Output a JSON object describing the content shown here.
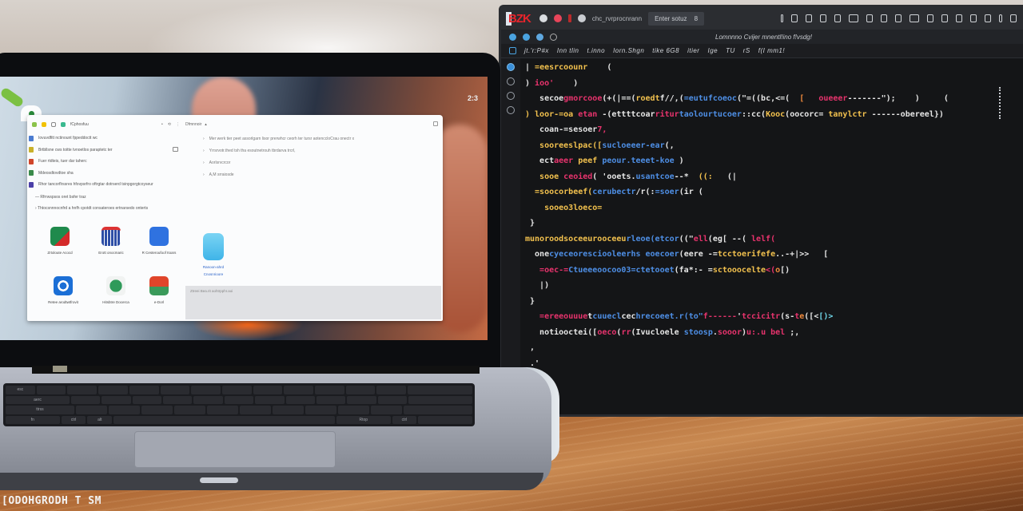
{
  "monitor": {
    "logo": "BZK",
    "topbar_text": "chc_rvrprocnrann",
    "tab_label": "Enter sotuz",
    "tab_count": "8",
    "editor_title": "Lomnnno   Cvijer mnentl!ino f!vsdg!",
    "menu_items": [
      "jt.'r:P#x",
      "Inn tlin",
      "t.inno",
      "Iorn.Shgn",
      "tike 6G8",
      "itier",
      "Ige",
      "TU",
      "rS",
      "f(I mm1!"
    ],
    "code_lines": [
      [
        {
          "t": "| ",
          "c": "w"
        },
        {
          "t": "=eesrcoounr",
          "c": "y"
        },
        {
          "t": "    (",
          "c": "w"
        }
      ],
      [
        {
          "t": ") ",
          "c": "w"
        },
        {
          "t": "ioo'",
          "c": "p"
        },
        {
          "t": "    )",
          "c": "w"
        }
      ],
      [
        {
          "t": "   secoe",
          "c": "w"
        },
        {
          "t": "gmorcooe",
          "c": "p"
        },
        {
          "t": "(+(|==(",
          "c": "w"
        },
        {
          "t": "roedt",
          "c": "y"
        },
        {
          "t": "f//,(",
          "c": "w"
        },
        {
          "t": "=eutufcoeoc",
          "c": "b"
        },
        {
          "t": "(\"=((bc,<=(  ",
          "c": "w"
        },
        {
          "t": "[",
          "c": "o"
        },
        {
          "t": "   ",
          "c": "w"
        },
        {
          "t": "oueeer",
          "c": "p"
        },
        {
          "t": "-------\");    )     (",
          "c": "w"
        }
      ],
      [
        {
          "t": ") loor-=oa ",
          "c": "y"
        },
        {
          "t": "etan",
          "c": "p"
        },
        {
          "t": " -(ettttcoar",
          "c": "w"
        },
        {
          "t": "ritur",
          "c": "p"
        },
        {
          "t": "taolourtucoer",
          "c": "b"
        },
        {
          "t": "::cc(",
          "c": "w"
        },
        {
          "t": "Kooc",
          "c": "y"
        },
        {
          "t": "(oocorc=",
          "c": "w"
        },
        {
          "t": " tanylctr ",
          "c": "y"
        },
        {
          "t": "------obereel",
          "c": "w"
        },
        {
          "t": "})",
          "c": "w"
        }
      ],
      [
        {
          "t": "   coan-=sesoer",
          "c": "w"
        },
        {
          "t": "7,",
          "c": "p"
        }
      ],
      [
        {
          "t": "   sooreeslpac([",
          "c": "y"
        },
        {
          "t": "sucloeeer-ear",
          "c": "b"
        },
        {
          "t": "(,",
          "c": "w"
        }
      ],
      [
        {
          "t": "   ect",
          "c": "w"
        },
        {
          "t": "aeer",
          "c": "p"
        },
        {
          "t": " peef ",
          "c": "y"
        },
        {
          "t": "peour.teeet-koe",
          "c": "b"
        },
        {
          "t": " )",
          "c": "w"
        }
      ],
      [
        {
          "t": "   sooe ",
          "c": "y"
        },
        {
          "t": "ceo",
          "c": "p"
        },
        {
          "t": "ied",
          "c": "p"
        },
        {
          "t": "( 'ooets.",
          "c": "w"
        },
        {
          "t": "usantcoe",
          "c": "b"
        },
        {
          "t": "--*  ",
          "c": "w"
        },
        {
          "t": "((:",
          "c": "y"
        },
        {
          "t": "   (|",
          "c": "w"
        }
      ],
      [
        {
          "t": "  =soocorbeef(",
          "c": "y"
        },
        {
          "t": "cerubectr",
          "c": "b"
        },
        {
          "t": "/r(:",
          "c": "w"
        },
        {
          "t": "=soer",
          "c": "b"
        },
        {
          "t": "(ir (",
          "c": "w"
        }
      ],
      [
        {
          "t": "    sooeo3loeco=",
          "c": "y"
        }
      ],
      [
        {
          "t": " }",
          "c": "w"
        }
      ],
      [
        {
          "t": "munoroodsoceeurooceeu",
          "c": "y"
        },
        {
          "t": "rleoe(etcor",
          "c": "b"
        },
        {
          "t": "((\"",
          "c": "w"
        },
        {
          "t": "ell",
          "c": "p"
        },
        {
          "t": "(eg[ --( ",
          "c": "w"
        },
        {
          "t": "lelf(",
          "c": "p"
        }
      ],
      [
        {
          "t": "  one",
          "c": "w"
        },
        {
          "t": "cyeceoresciooleerhs",
          "c": "b"
        },
        {
          "t": " eoecoer",
          "c": "b"
        },
        {
          "t": "(eere -=",
          "c": "w"
        },
        {
          "t": "tcctoerifefe",
          "c": "y"
        },
        {
          "t": "..-+|>>   [",
          "c": "w"
        }
      ],
      [
        {
          "t": "   =oec-=",
          "c": "p"
        },
        {
          "t": "Ctueeeoocoo03=ctetooet",
          "c": "b"
        },
        {
          "t": "(fa*:- =",
          "c": "w"
        },
        {
          "t": "sctooocelte",
          "c": "y"
        },
        {
          "t": "<(",
          "c": "p"
        },
        {
          "t": "o",
          "c": "o"
        },
        {
          "t": "[)",
          "c": "w"
        }
      ],
      [
        {
          "t": "   |)",
          "c": "w"
        }
      ],
      [
        {
          "t": " }",
          "c": "w"
        }
      ],
      [
        {
          "t": "   =ereeo",
          "c": "p"
        },
        {
          "t": "uuue",
          "c": "p"
        },
        {
          "t": "t",
          "c": "w"
        },
        {
          "t": "cuuecl",
          "c": "b"
        },
        {
          "t": "cec",
          "c": "w"
        },
        {
          "t": "hrecoeet.r(to\"",
          "c": "b"
        },
        {
          "t": "f------",
          "c": "p"
        },
        {
          "t": "'",
          "c": "w"
        },
        {
          "t": "tccicitr",
          "c": "p"
        },
        {
          "t": "(s-",
          "c": "w"
        },
        {
          "t": "t",
          "c": "p"
        },
        {
          "t": "e",
          "c": "o"
        },
        {
          "t": "([<",
          "c": "w"
        },
        {
          "t": "[)>",
          "c": "c"
        }
      ],
      [
        {
          "t": "   notiooctei([",
          "c": "w"
        },
        {
          "t": "oeco",
          "c": "p"
        },
        {
          "t": "(",
          "c": "w"
        },
        {
          "t": "rr",
          "c": "p"
        },
        {
          "t": "(Ivucloele ",
          "c": "w"
        },
        {
          "t": "stoosp",
          "c": "b"
        },
        {
          "t": ".",
          "c": "w"
        },
        {
          "t": "sooor",
          "c": "p"
        },
        {
          "t": ")",
          "c": "w"
        },
        {
          "t": "u:.u",
          "c": "p"
        },
        {
          "t": " bel ",
          "c": "p"
        },
        {
          "t": ";,",
          "c": "w"
        }
      ],
      [
        {
          "t": " ,",
          "c": "w"
        }
      ],
      [
        {
          "t": " .'",
          "c": "w"
        }
      ],
      [
        {
          "t": "}",
          "c": "w"
        }
      ]
    ]
  },
  "laptop": {
    "clock": "2:3",
    "browser": {
      "toolbar_title": "fCphosfuu",
      "pane_title": "Dfmnnoir",
      "list_items": [
        {
          "label": "Iovuvdfitt nctinount fppeddoctt wc",
          "color": "#4a7bd0"
        },
        {
          "label": "Brtbllsne cws toitte tvnoetlos paraptetc ter",
          "color": "#c9b12a"
        },
        {
          "label": "Fuer rtdteis, tuer dar taherc",
          "color": "#d0452a"
        },
        {
          "label": "Mdeosdtovdtoe sha",
          "color": "#3a8a4a"
        },
        {
          "label": "Rhor tancorflrssres hfovpsrfro oftrgtar dotrserd tsinpgorgtcoyseur",
          "color": "#4b3fa8"
        }
      ],
      "section_1": "Rfrrwspsos oret bsfer traz",
      "section_2": "Thtocsnnnocnfrd a hnfh cpotdt consateroes ertnarsedo onterts",
      "pane_items": [
        "Mer werk tier peet assorlgarn lisor prerwhcr ceorh ter tursr aotenccloCrau onectr x",
        "Yrrsrvotr.thed tsh tha esoutnetrouh tbrdarva trcrl,",
        "Aorlsrvcrcor",
        "A,M srraiosde"
      ],
      "apps": [
        {
          "label": "Zrtoloute Acocd",
          "color": "#1f8a4c"
        },
        {
          "label": "Erott onocmaric",
          "color": "#2d4ea6"
        },
        {
          "label": "R Cesteroufoof Itoars",
          "color": "#2f72e0"
        },
        {
          "label": "Retee arodtwtfrovit",
          "color": "#1b6fd6"
        },
        {
          "label": "Hitsbtre Docerca",
          "color": "#2f9a5a"
        },
        {
          "label": "e-Dorl",
          "color": "#e0452a"
        }
      ],
      "big_app": {
        "label_1": "Ranoon-ahrd",
        "label_2": "Cnosnrioore"
      },
      "footer_text": "Ztreei Bea.rit aohtrpphr.aoi"
    },
    "keyboard_labels": [
      "esc",
      "aerc",
      "ttrss",
      "fn",
      "ctrl",
      "alt",
      "Rtop",
      "ctrl"
    ]
  },
  "watermark": "[ODOHGRODH T SM"
}
